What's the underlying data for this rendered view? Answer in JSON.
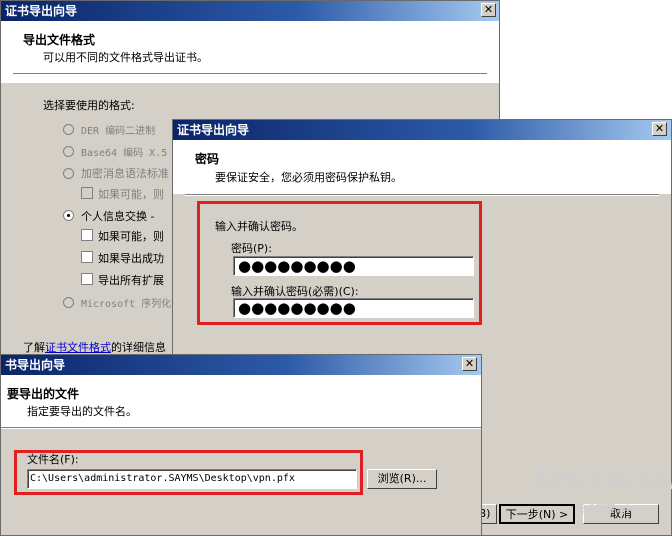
{
  "window1": {
    "title": "证书导出向导",
    "close": "✕",
    "header_title": "导出文件格式",
    "header_subtitle": "可以用不同的文件格式导出证书。",
    "select_label": "选择要使用的格式:",
    "options": [
      {
        "label": "DER 编码二进制",
        "enabled": false,
        "selected": false
      },
      {
        "label": "Base64 编码 X.5",
        "enabled": false,
        "selected": false
      },
      {
        "label": "加密消息语法标准",
        "enabled": false,
        "selected": false
      }
    ],
    "sub_check_1": "如果可能，则",
    "pfx_option": "个人信息交换 -",
    "pfx_checks": [
      "如果可能，则",
      "如果导出成功",
      "导出所有扩展"
    ],
    "ms_option": "Microsoft 序列化",
    "learn_prefix": "了解",
    "learn_link": "证书文件格式",
    "learn_suffix": "的详细信息"
  },
  "window2": {
    "title": "证书导出向导",
    "close": "✕",
    "header_title": "密码",
    "header_subtitle": "要保证安全，您必须用密码保护私钥。",
    "prompt": "输入并确认密码。",
    "password_label": "密码(P):",
    "password_value": "●●●●●●●●●",
    "confirm_label": "输入并确认密码(必需)(C):",
    "confirm_value": "●●●●●●●●●",
    "next_button": "下一步(N) >",
    "back_button": "B)",
    "cancel_button": "取消"
  },
  "window3": {
    "title": "书导出向导",
    "close": "✕",
    "header_title": "要导出的文件",
    "header_subtitle": "指定要导出的文件名。",
    "filename_label": "文件名(F):",
    "filename_value": "C:\\Users\\administrator.SAYMS\\Desktop\\vpn.pfx",
    "browse_button": "浏览(R)..."
  },
  "watermark": {
    "logo": "51CTO.com",
    "tag": "技术博客 Blog"
  },
  "colors": {
    "highlight_box": "#e02020",
    "titlebar_start": "#0a246a",
    "titlebar_end": "#a6caf0",
    "dialog_bg": "#d4d0c8"
  }
}
